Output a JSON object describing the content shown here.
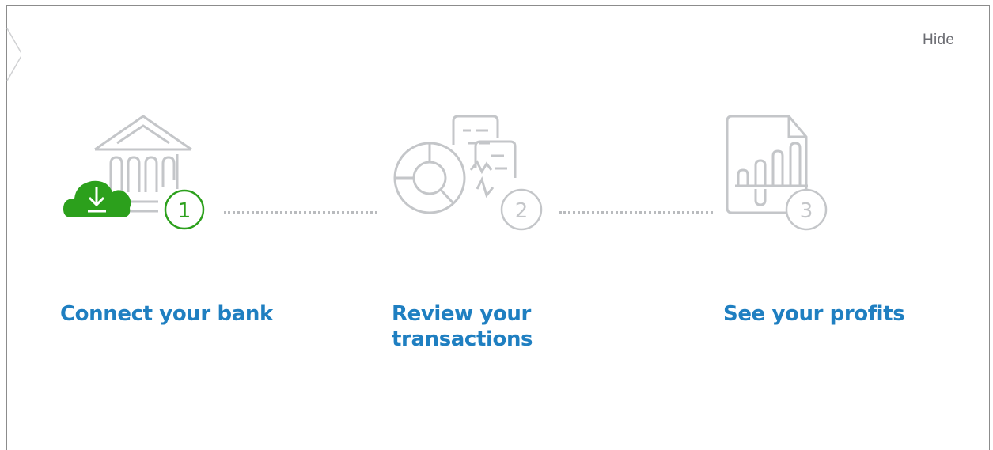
{
  "header": {
    "hide_label": "Hide"
  },
  "steps": [
    {
      "number": "1",
      "label": "Connect your bank",
      "icon": "bank-icon",
      "state": "active"
    },
    {
      "number": "2",
      "label": "Review your transactions",
      "label_line1": "Review your",
      "label_line2": "transactions",
      "icon": "transactions-review-icon",
      "state": "inactive"
    },
    {
      "number": "3",
      "label": "See your profits",
      "icon": "profit-report-icon",
      "state": "inactive"
    }
  ],
  "colors": {
    "accent_green": "#2ca01c",
    "link_blue": "#1f7fc1",
    "icon_gray": "#c4c6c9",
    "text_gray": "#6b6c72"
  }
}
